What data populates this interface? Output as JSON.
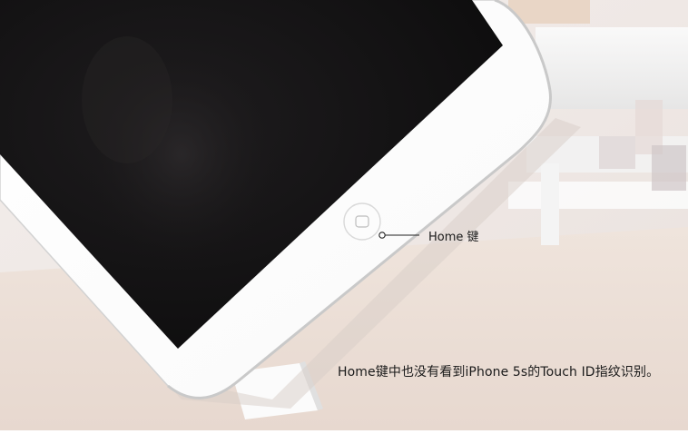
{
  "annotation": {
    "callout_label": "Home 键",
    "caption": "Home键中也没有看到iPhone 5s的Touch ID指纹识别。"
  }
}
